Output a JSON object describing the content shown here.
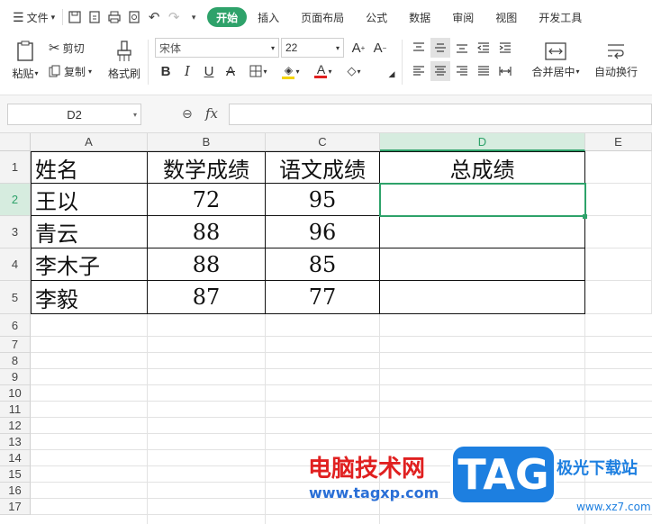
{
  "menubar": {
    "file_label": "文件",
    "tabs": [
      {
        "label": "开始",
        "active": true
      },
      {
        "label": "插入",
        "active": false
      },
      {
        "label": "页面布局",
        "active": false
      },
      {
        "label": "公式",
        "active": false
      },
      {
        "label": "数据",
        "active": false
      },
      {
        "label": "审阅",
        "active": false
      },
      {
        "label": "视图",
        "active": false
      },
      {
        "label": "开发工具",
        "active": false
      }
    ]
  },
  "ribbon": {
    "paste_label": "粘贴",
    "cut_label": "剪切",
    "copy_label": "复制",
    "format_painter_label": "格式刷",
    "font_name": "宋体",
    "font_size": "22",
    "merge_center_label": "合并居中",
    "wrap_text_label": "自动换行"
  },
  "formula_bar": {
    "cell_reference": "D2",
    "fx_label": "fx",
    "formula_value": ""
  },
  "sheet": {
    "columns": [
      "A",
      "B",
      "C",
      "D",
      "E"
    ],
    "selected_column": "D",
    "rows": [
      "1",
      "2",
      "3",
      "4",
      "5",
      "6",
      "7",
      "8",
      "9",
      "10",
      "11",
      "12",
      "13",
      "14",
      "15",
      "16",
      "17"
    ],
    "selected_row": "2",
    "header_row": [
      "姓名",
      "数学成绩",
      "语文成绩",
      "总成绩"
    ],
    "data_rows": [
      [
        "王以",
        "72",
        "95",
        ""
      ],
      [
        "青云",
        "88",
        "96",
        ""
      ],
      [
        "李木子",
        "88",
        "85",
        ""
      ],
      [
        "李毅",
        "87",
        "77",
        ""
      ]
    ]
  },
  "watermark": {
    "site_name": "电脑技术网",
    "url": "www.tagxp.com",
    "tag_logo": "TAG",
    "site2_name": "极光下载站",
    "site2_url": "www.xz7.com"
  },
  "colors": {
    "accent": "#2ea26a",
    "watermark_red": "#e02020",
    "watermark_blue": "#1d7fe0"
  }
}
